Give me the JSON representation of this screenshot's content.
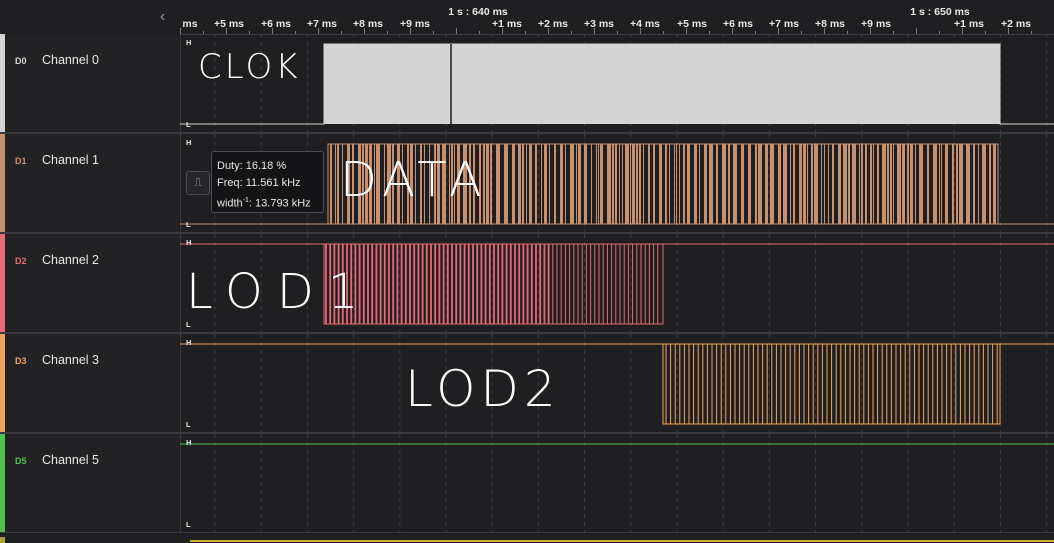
{
  "ruler": {
    "collapse_icon": "chevron-left-icon",
    "minor_ticks": [
      {
        "label": "ms"
      },
      {
        "label": "+5 ms"
      },
      {
        "label": "+6 ms"
      },
      {
        "label": "+7 ms"
      },
      {
        "label": "+8 ms"
      },
      {
        "label": "+9 ms"
      },
      {
        "label": "+1 ms"
      },
      {
        "label": "+2 ms"
      },
      {
        "label": "+3 ms"
      },
      {
        "label": "+4 ms"
      },
      {
        "label": "+5 ms"
      },
      {
        "label": "+6 ms"
      },
      {
        "label": "+7 ms"
      },
      {
        "label": "+8 ms"
      },
      {
        "label": "+9 ms"
      },
      {
        "label": "+1 ms"
      },
      {
        "label": "+2 ms"
      }
    ],
    "major_ticks": [
      {
        "label": "1 s : 640 ms"
      },
      {
        "label": "1 s : 650 ms"
      }
    ]
  },
  "channels": [
    {
      "id": "D0",
      "name": "Channel 0",
      "color": "#d4d4d4",
      "annotation": "CLOK"
    },
    {
      "id": "D1",
      "name": "Channel 1",
      "color": "#c7906e",
      "annotation": "DATA"
    },
    {
      "id": "D2",
      "name": "Channel 2",
      "color": "#e86a74",
      "annotation": "LOD1"
    },
    {
      "id": "D3",
      "name": "Channel 3",
      "color": "#f2a35a",
      "annotation": "LOD2"
    },
    {
      "id": "D5",
      "name": "Channel 5",
      "color": "#4cc44c",
      "annotation": ""
    }
  ],
  "level_labels": {
    "high": "H",
    "low": "L"
  },
  "tooltip": {
    "duty": "Duty: 16.18 %",
    "freq": "Freq: 11.561 kHz",
    "width_prefix": "width",
    "width_sup": "-1",
    "width_value": ": 13.793 kHz"
  },
  "measure_button": {
    "icon": "pulse-measure-icon",
    "glyph": "⎍"
  }
}
